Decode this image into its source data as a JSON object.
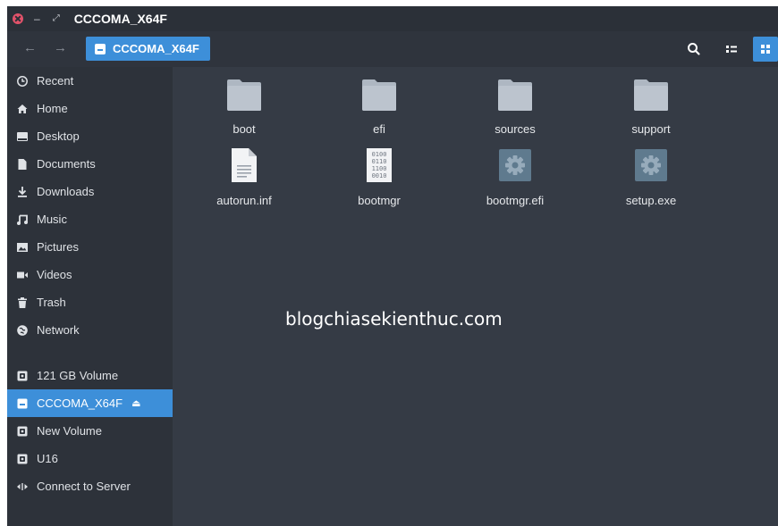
{
  "window": {
    "title": "CCCOMA_X64F"
  },
  "toolbar": {
    "path_label": "CCCOMA_X64F",
    "back_icon": "arrow-left-icon",
    "forward_icon": "arrow-right-icon",
    "accent_color": "#3d8fd9"
  },
  "sidebar": {
    "places": [
      {
        "label": "Recent",
        "icon": "clock-icon"
      },
      {
        "label": "Home",
        "icon": "home-icon"
      },
      {
        "label": "Desktop",
        "icon": "desktop-icon"
      },
      {
        "label": "Documents",
        "icon": "document-icon"
      },
      {
        "label": "Downloads",
        "icon": "download-icon"
      },
      {
        "label": "Music",
        "icon": "music-icon"
      },
      {
        "label": "Pictures",
        "icon": "picture-icon"
      },
      {
        "label": "Videos",
        "icon": "video-icon"
      },
      {
        "label": "Trash",
        "icon": "trash-icon"
      },
      {
        "label": "Network",
        "icon": "network-icon"
      }
    ],
    "devices": [
      {
        "label": "121 GB Volume",
        "icon": "drive-icon"
      },
      {
        "label": "CCCOMA_X64F",
        "icon": "removable-drive-icon",
        "active": true,
        "eject": "⏏"
      },
      {
        "label": "New Volume",
        "icon": "drive-icon"
      },
      {
        "label": "U16",
        "icon": "drive-icon"
      },
      {
        "label": "Connect to Server",
        "icon": "connect-server-icon"
      }
    ]
  },
  "files": [
    {
      "name": "boot",
      "type": "folder"
    },
    {
      "name": "efi",
      "type": "folder"
    },
    {
      "name": "sources",
      "type": "folder"
    },
    {
      "name": "support",
      "type": "folder"
    },
    {
      "name": "autorun.inf",
      "type": "text"
    },
    {
      "name": "bootmgr",
      "type": "binary"
    },
    {
      "name": "bootmgr.efi",
      "type": "executable"
    },
    {
      "name": "setup.exe",
      "type": "executable"
    }
  ],
  "binary_icon_text": [
    "0100",
    "0110",
    "1100",
    "0010"
  ],
  "watermark": "blogchiasekienthuc.com"
}
